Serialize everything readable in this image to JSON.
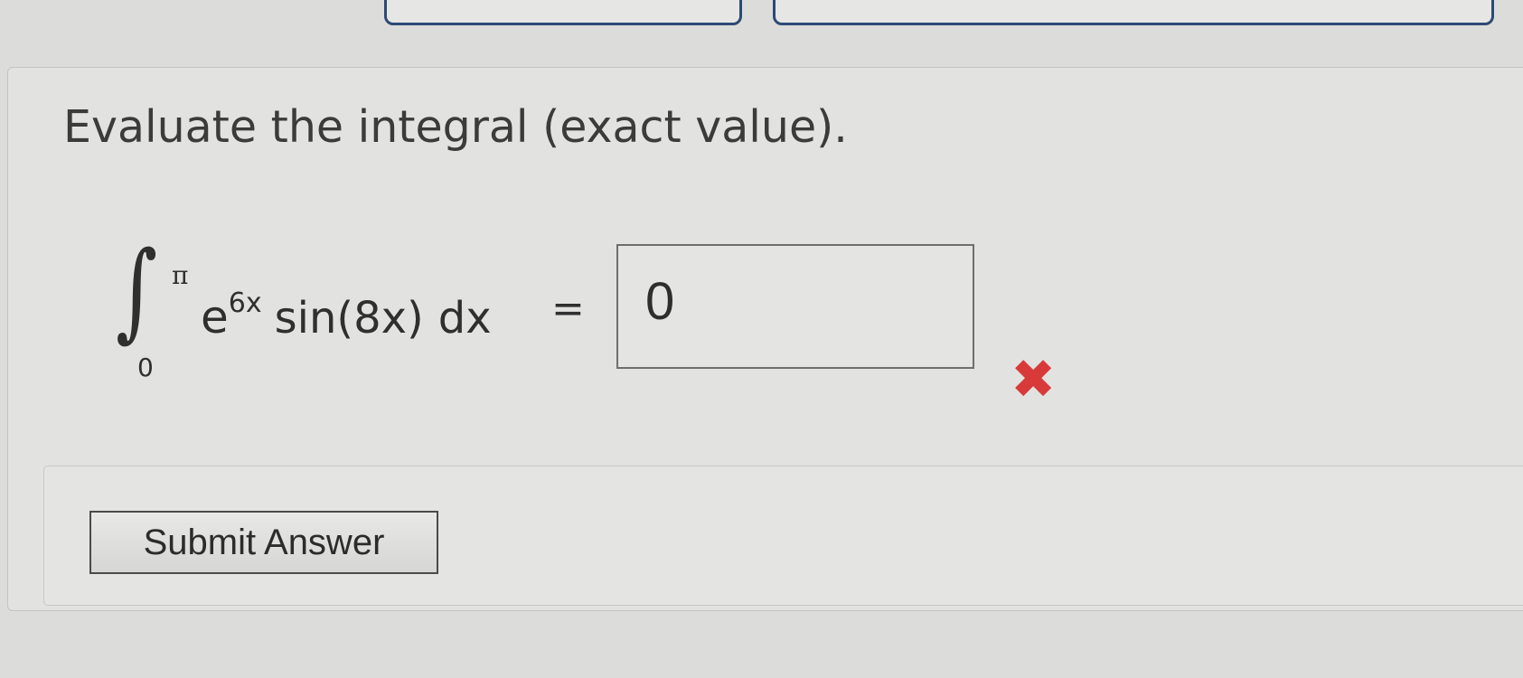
{
  "question": {
    "prompt": "Evaluate the integral (exact value).",
    "integral": {
      "symbol": "∫",
      "upper_limit": "π",
      "lower_limit": "0",
      "base": "e",
      "exponent": "6x",
      "function": "sin(8x)",
      "differential": "dx",
      "equals": "="
    },
    "answer_value": "0",
    "answer_status": "incorrect",
    "status_icon": "x-mark-icon",
    "status_color": "#d83a3a"
  },
  "actions": {
    "submit_label": "Submit Answer"
  }
}
